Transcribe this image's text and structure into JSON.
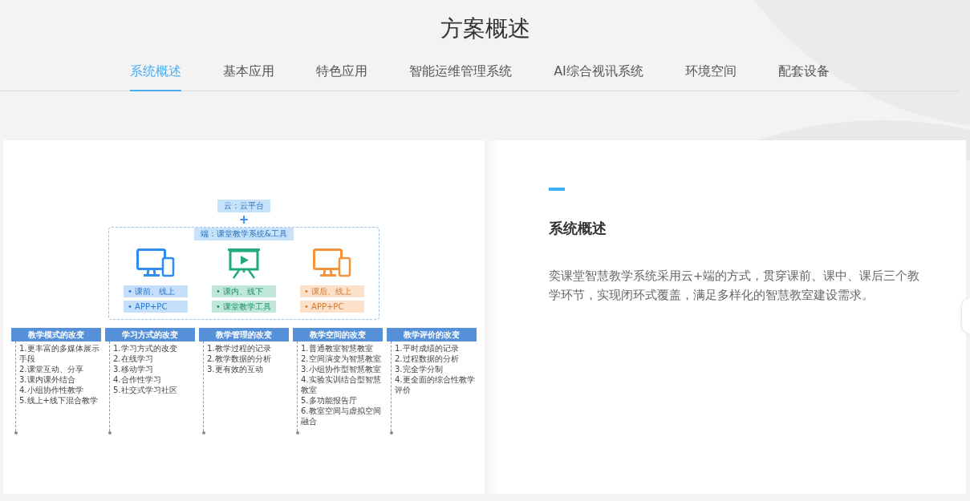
{
  "header": {
    "title": "方案概述"
  },
  "tabs": [
    {
      "label": "系统概述",
      "selected": true
    },
    {
      "label": "基本应用",
      "selected": false
    },
    {
      "label": "特色应用",
      "selected": false
    },
    {
      "label": "智能运维管理系统",
      "selected": false
    },
    {
      "label": "AI综合视讯系统",
      "selected": false
    },
    {
      "label": "环境空间",
      "selected": false
    },
    {
      "label": "配套设备",
      "selected": false
    }
  ],
  "diagram": {
    "cloud": "云：云平台",
    "connector": "+",
    "terminal": "端：课堂教学系统&工具",
    "devices": [
      {
        "kind": "computer",
        "color": "#2f8cf0",
        "tags": [
          "• 课前、线上",
          "• APP+PC"
        ]
      },
      {
        "kind": "projector",
        "color": "#22aa78",
        "tags": [
          "• 课内、线下",
          "• 课堂教学工具"
        ]
      },
      {
        "kind": "computer",
        "color": "#f5923e",
        "tags": [
          "• 课后、线上",
          "• APP+PC"
        ]
      }
    ],
    "columns": [
      {
        "title": "教学模式的改变",
        "items": [
          "1.更丰富的多媒体展示手段",
          "2.课堂互动、分享",
          "3.课内课外结合",
          "4.小组协作性教学",
          "5.线上+线下混合教学"
        ]
      },
      {
        "title": "学习方式的改变",
        "items": [
          "1.学习方式的改变",
          "2.在线学习",
          "3.移动学习",
          "4.合作性学习",
          "5.社交式学习社区"
        ]
      },
      {
        "title": "教学管理的改变",
        "items": [
          "1.教学过程的记录",
          "2.教学数据的分析",
          "3.更有效的互动"
        ]
      },
      {
        "title": "教学空间的改变",
        "items": [
          "1.普通教室智慧教室",
          "2.空间演变为智慧教室",
          "3.小组协作型智慧教室",
          "4.实验实训结合型智慧教室",
          "5.多功能报告厅",
          "6.教室空间与虚拟空间融合"
        ]
      },
      {
        "title": "教学评价的改变",
        "items": [
          "1.平时成绩的记录",
          "2.过程数据的分析",
          "3.完全学分制",
          "4.更全面的综合性教学评价"
        ]
      }
    ]
  },
  "detail": {
    "heading": "系统概述",
    "text": "奕课堂智慧教学系统采用云+端的方式，贯穿课前、课中、课后三个教学环节，实现闭环式覆盖，满足多样化的智慧教室建设需求。"
  }
}
